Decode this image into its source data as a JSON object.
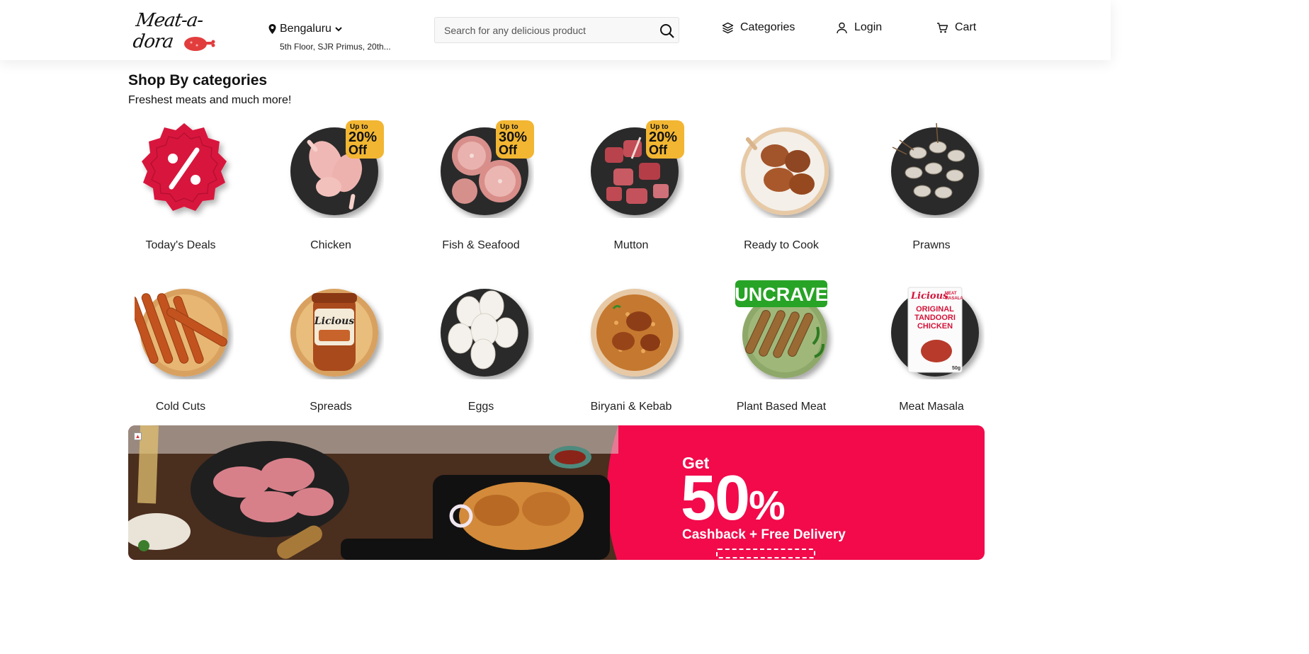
{
  "header": {
    "logo_text": "Meat-a-dora",
    "location": {
      "city": "Bengaluru",
      "address": "5th Floor, SJR Primus, 20th..."
    },
    "search": {
      "placeholder": "Search for any delicious product"
    },
    "nav": {
      "categories": "Categories",
      "login": "Login",
      "cart": "Cart"
    }
  },
  "section": {
    "title": "Shop By categories",
    "subtitle": "Freshest meats and much more!"
  },
  "categories": [
    {
      "label": "Today's Deals",
      "icon": "deals-badge-icon"
    },
    {
      "label": "Chicken",
      "badge_top": "Up to",
      "badge_value": "20%",
      "badge_off": "Off"
    },
    {
      "label": "Fish & Seafood",
      "badge_top": "Up to",
      "badge_value": "30%",
      "badge_off": "Off"
    },
    {
      "label": "Mutton",
      "badge_top": "Up to",
      "badge_value": "20%",
      "badge_off": "Off"
    },
    {
      "label": "Ready to Cook"
    },
    {
      "label": "Prawns"
    },
    {
      "label": "Cold Cuts"
    },
    {
      "label": "Spreads",
      "jar_brand": "Licious"
    },
    {
      "label": "Eggs"
    },
    {
      "label": "Biryani & Kebab"
    },
    {
      "label": "Plant Based Meat",
      "brand_tag": "UNCRAVE"
    },
    {
      "label": "Meat Masala",
      "pack_brand": "Licious",
      "pack_line1": "MEAT",
      "pack_line2": "MASALA",
      "pack_title1": "ORIGINAL",
      "pack_title2": "TANDOORI",
      "pack_title3": "CHICKEN",
      "pack_weight": "50g"
    }
  ],
  "banner": {
    "get": "Get",
    "percent": "50",
    "percent_sign": "%",
    "subtitle": "Cashback + Free Delivery"
  },
  "colors": {
    "accent": "#f20a4b",
    "deal_red": "#d8143c",
    "badge_gold": "#f2b632",
    "plate_dark": "#2a2a2a",
    "plate_wood": "#d9a15e"
  }
}
